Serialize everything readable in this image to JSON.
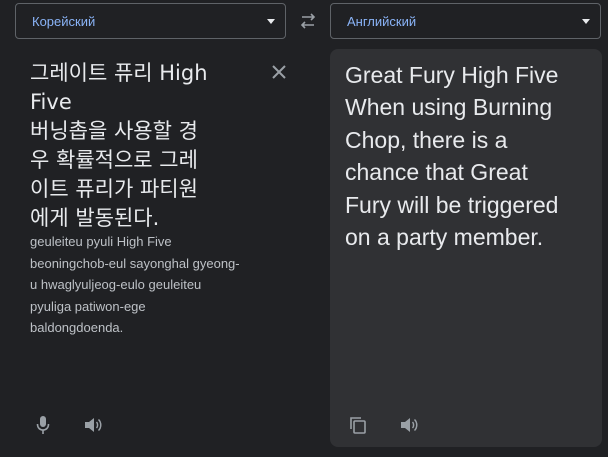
{
  "source_lang": {
    "label": "Корейский"
  },
  "target_lang": {
    "label": "Английский"
  },
  "source": {
    "text": "그레이트 퓨리 High\nFive\n버닝촙을 사용할 경\n우 확률적으로 그레\n이트 퓨리가 파티원\n에게 발동된다.",
    "romanization": "geuleiteu pyuli High Five\nbeoningchob-eul sayonghal gyeong-\nu hwaglyuljeog-eulo geuleiteu\npyuliga patiwon-ege\nbaldongdoenda."
  },
  "target": {
    "text": "Great Fury High Five\nWhen using Burning\nChop, there is a\nchance that Great\nFury will be triggered\non a party member."
  },
  "icons": {
    "swap": "swap-arrows-icon",
    "clear": "close-icon",
    "mic": "microphone-icon",
    "speak": "speaker-icon",
    "copy": "copy-icon"
  },
  "colors": {
    "background": "#202124",
    "panel": "#303134",
    "accent": "#8ab4f8",
    "icon": "#9aa0a6",
    "text": "#e8eaed"
  }
}
